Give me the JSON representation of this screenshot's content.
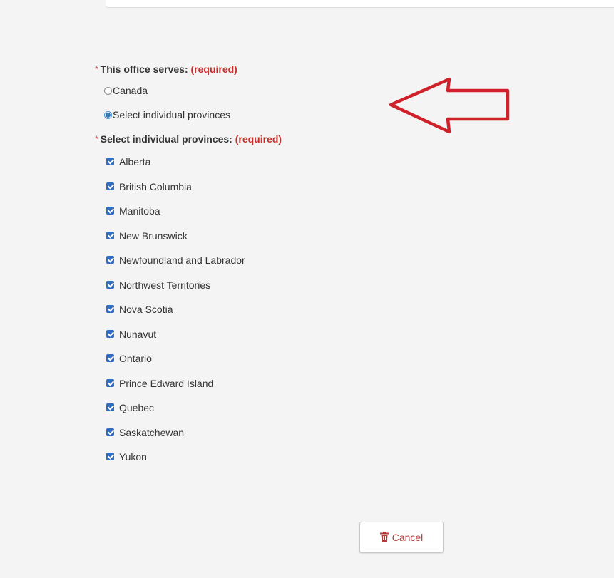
{
  "office_serves": {
    "asterisk": "*",
    "label": "This office serves:",
    "required_text": "(required)",
    "options": [
      {
        "label": "Canada",
        "checked": false
      },
      {
        "label": "Select individual provinces",
        "checked": true
      }
    ]
  },
  "provinces": {
    "asterisk": "*",
    "label": "Select individual provinces:",
    "required_text": "(required)",
    "items": [
      {
        "label": "Alberta",
        "checked": true
      },
      {
        "label": "British Columbia",
        "checked": true
      },
      {
        "label": "Manitoba",
        "checked": true
      },
      {
        "label": "New Brunswick",
        "checked": true
      },
      {
        "label": "Newfoundland and Labrador",
        "checked": true
      },
      {
        "label": "Northwest Territories",
        "checked": true
      },
      {
        "label": "Nova Scotia",
        "checked": true
      },
      {
        "label": "Nunavut",
        "checked": true
      },
      {
        "label": "Ontario",
        "checked": true
      },
      {
        "label": "Prince Edward Island",
        "checked": true
      },
      {
        "label": "Quebec",
        "checked": true
      },
      {
        "label": "Saskatchewan",
        "checked": true
      },
      {
        "label": "Yukon",
        "checked": true
      }
    ]
  },
  "actions": {
    "cancel_label": "Cancel",
    "cancel_icon": "trash-icon"
  },
  "annotation": {
    "arrow_icon": "red-arrow-left-icon",
    "arrow_color": "#d0202a"
  },
  "colors": {
    "required_red": "#c9302c",
    "checkbox_blue": "#2f6ec0",
    "background": "#f4f4f4"
  }
}
